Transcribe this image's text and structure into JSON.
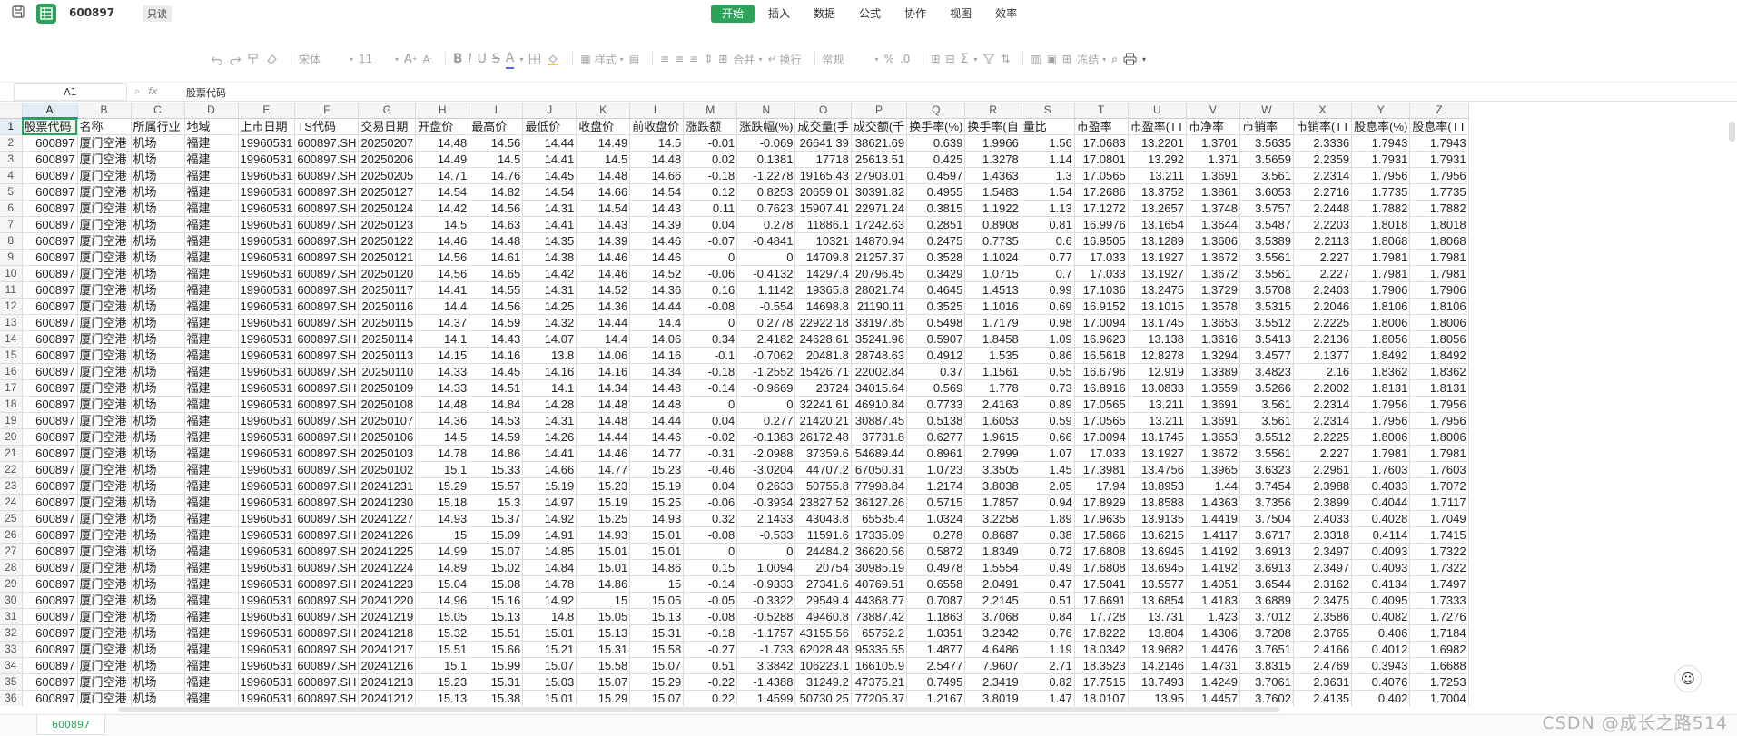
{
  "app": {
    "file_name": "600897",
    "mode_badge": "只读",
    "brand_color": "#2ba35a"
  },
  "menu_tabs": [
    "开始",
    "插入",
    "数据",
    "公式",
    "协作",
    "视图",
    "效率"
  ],
  "toolbar": {
    "font_name": "宋体",
    "font_size": "11",
    "style_label": "样式",
    "format_label": "常规",
    "merge_label": "合并",
    "wrap_label": "换行",
    "freeze_label": "冻结"
  },
  "formula_bar": {
    "cell_ref": "A1",
    "content": "股票代码"
  },
  "grid": {
    "columns": [
      "A",
      "B",
      "C",
      "D",
      "E",
      "F",
      "G",
      "H",
      "I",
      "J",
      "K",
      "L",
      "M",
      "N",
      "O",
      "P",
      "Q",
      "R",
      "S",
      "T",
      "U",
      "V",
      "W",
      "X",
      "Y",
      "Z"
    ],
    "rows": [
      [
        "股票代码",
        "名称",
        "所属行业",
        "地域",
        "上市日期",
        "TS代码",
        "交易日期",
        "开盘价",
        "最高价",
        "最低价",
        "收盘价",
        "前收盘价",
        "涨跌额",
        "涨跌幅(%)",
        "成交量(手",
        "成交额(千",
        "换手率(%)",
        "换手率(自",
        "量比",
        "市盈率",
        "市盈率(TT",
        "市净率",
        "市销率",
        "市销率(TT",
        "股息率(%)",
        "股息率(TT"
      ],
      [
        "600897",
        "厦门空港",
        "机场",
        "福建",
        "19960531",
        "600897.SH",
        "20250207",
        "14.48",
        "14.56",
        "14.44",
        "14.49",
        "14.5",
        "-0.01",
        "-0.069",
        "26641.39",
        "38621.69",
        "0.639",
        "1.9966",
        "1.56",
        "17.0683",
        "13.2201",
        "1.3701",
        "3.5635",
        "2.3336",
        "1.7943",
        "1.7943"
      ],
      [
        "600897",
        "厦门空港",
        "机场",
        "福建",
        "19960531",
        "600897.SH",
        "20250206",
        "14.49",
        "14.5",
        "14.41",
        "14.5",
        "14.48",
        "0.02",
        "0.1381",
        "17718",
        "25613.51",
        "0.425",
        "1.3278",
        "1.14",
        "17.0801",
        "13.292",
        "1.371",
        "3.5659",
        "2.2359",
        "1.7931",
        "1.7931"
      ],
      [
        "600897",
        "厦门空港",
        "机场",
        "福建",
        "19960531",
        "600897.SH",
        "20250205",
        "14.71",
        "14.76",
        "14.45",
        "14.48",
        "14.66",
        "-0.18",
        "-1.2278",
        "19165.43",
        "27903.01",
        "0.4597",
        "1.4363",
        "1.3",
        "17.0565",
        "13.211",
        "1.3691",
        "3.561",
        "2.2314",
        "1.7956",
        "1.7956"
      ],
      [
        "600897",
        "厦门空港",
        "机场",
        "福建",
        "19960531",
        "600897.SH",
        "20250127",
        "14.54",
        "14.82",
        "14.54",
        "14.66",
        "14.54",
        "0.12",
        "0.8253",
        "20659.01",
        "30391.82",
        "0.4955",
        "1.5483",
        "1.54",
        "17.2686",
        "13.3752",
        "1.3861",
        "3.6053",
        "2.2716",
        "1.7735",
        "1.7735"
      ],
      [
        "600897",
        "厦门空港",
        "机场",
        "福建",
        "19960531",
        "600897.SH",
        "20250124",
        "14.42",
        "14.56",
        "14.31",
        "14.54",
        "14.43",
        "0.11",
        "0.7623",
        "15907.41",
        "22971.24",
        "0.3815",
        "1.1922",
        "1.13",
        "17.1272",
        "13.2657",
        "1.3748",
        "3.5757",
        "2.2448",
        "1.7882",
        "1.7882"
      ],
      [
        "600897",
        "厦门空港",
        "机场",
        "福建",
        "19960531",
        "600897.SH",
        "20250123",
        "14.5",
        "14.63",
        "14.41",
        "14.43",
        "14.39",
        "0.04",
        "0.278",
        "11886.1",
        "17242.63",
        "0.2851",
        "0.8908",
        "0.81",
        "16.9976",
        "13.1654",
        "1.3644",
        "3.5487",
        "2.2203",
        "1.8018",
        "1.8018"
      ],
      [
        "600897",
        "厦门空港",
        "机场",
        "福建",
        "19960531",
        "600897.SH",
        "20250122",
        "14.46",
        "14.48",
        "14.35",
        "14.39",
        "14.46",
        "-0.07",
        "-0.4841",
        "10321",
        "14870.94",
        "0.2475",
        "0.7735",
        "0.6",
        "16.9505",
        "13.1289",
        "1.3606",
        "3.5389",
        "2.2113",
        "1.8068",
        "1.8068"
      ],
      [
        "600897",
        "厦门空港",
        "机场",
        "福建",
        "19960531",
        "600897.SH",
        "20250121",
        "14.56",
        "14.61",
        "14.38",
        "14.46",
        "14.46",
        "0",
        "0",
        "14709.8",
        "21257.37",
        "0.3528",
        "1.1024",
        "0.77",
        "17.033",
        "13.1927",
        "1.3672",
        "3.5561",
        "2.227",
        "1.7981",
        "1.7981"
      ],
      [
        "600897",
        "厦门空港",
        "机场",
        "福建",
        "19960531",
        "600897.SH",
        "20250120",
        "14.56",
        "14.65",
        "14.42",
        "14.46",
        "14.52",
        "-0.06",
        "-0.4132",
        "14297.4",
        "20796.45",
        "0.3429",
        "1.0715",
        "0.7",
        "17.033",
        "13.1927",
        "1.3672",
        "3.5561",
        "2.227",
        "1.7981",
        "1.7981"
      ],
      [
        "600897",
        "厦门空港",
        "机场",
        "福建",
        "19960531",
        "600897.SH",
        "20250117",
        "14.41",
        "14.55",
        "14.31",
        "14.52",
        "14.36",
        "0.16",
        "1.1142",
        "19365.8",
        "28021.74",
        "0.4645",
        "1.4513",
        "0.99",
        "17.1036",
        "13.2475",
        "1.3729",
        "3.5708",
        "2.2403",
        "1.7906",
        "1.7906"
      ],
      [
        "600897",
        "厦门空港",
        "机场",
        "福建",
        "19960531",
        "600897.SH",
        "20250116",
        "14.4",
        "14.56",
        "14.25",
        "14.36",
        "14.44",
        "-0.08",
        "-0.554",
        "14698.8",
        "21190.11",
        "0.3525",
        "1.1016",
        "0.69",
        "16.9152",
        "13.1015",
        "1.3578",
        "3.5315",
        "2.2046",
        "1.8106",
        "1.8106"
      ],
      [
        "600897",
        "厦门空港",
        "机场",
        "福建",
        "19960531",
        "600897.SH",
        "20250115",
        "14.37",
        "14.59",
        "14.32",
        "14.44",
        "14.4",
        "0",
        "0.2778",
        "22922.18",
        "33197.85",
        "0.5498",
        "1.7179",
        "0.98",
        "17.0094",
        "13.1745",
        "1.3653",
        "3.5512",
        "2.2225",
        "1.8006",
        "1.8006"
      ],
      [
        "600897",
        "厦门空港",
        "机场",
        "福建",
        "19960531",
        "600897.SH",
        "20250114",
        "14.1",
        "14.43",
        "14.07",
        "14.4",
        "14.06",
        "0.34",
        "2.4182",
        "24628.61",
        "35241.96",
        "0.5907",
        "1.8458",
        "1.09",
        "16.9623",
        "13.138",
        "1.3616",
        "3.5413",
        "2.2136",
        "1.8056",
        "1.8056"
      ],
      [
        "600897",
        "厦门空港",
        "机场",
        "福建",
        "19960531",
        "600897.SH",
        "20250113",
        "14.15",
        "14.16",
        "13.8",
        "14.06",
        "14.16",
        "-0.1",
        "-0.7062",
        "20481.8",
        "28748.63",
        "0.4912",
        "1.535",
        "0.86",
        "16.5618",
        "12.8278",
        "1.3294",
        "3.4577",
        "2.1377",
        "1.8492",
        "1.8492"
      ],
      [
        "600897",
        "厦门空港",
        "机场",
        "福建",
        "19960531",
        "600897.SH",
        "20250110",
        "14.33",
        "14.45",
        "14.16",
        "14.16",
        "14.34",
        "-0.18",
        "-1.2552",
        "15426.71",
        "22002.84",
        "0.37",
        "1.1561",
        "0.55",
        "16.6796",
        "12.919",
        "1.3389",
        "3.4823",
        "2.16",
        "1.8362",
        "1.8362"
      ],
      [
        "600897",
        "厦门空港",
        "机场",
        "福建",
        "19960531",
        "600897.SH",
        "20250109",
        "14.33",
        "14.51",
        "14.1",
        "14.34",
        "14.48",
        "-0.14",
        "-0.9669",
        "23724",
        "34015.64",
        "0.569",
        "1.778",
        "0.73",
        "16.8916",
        "13.0833",
        "1.3559",
        "3.5266",
        "2.2002",
        "1.8131",
        "1.8131"
      ],
      [
        "600897",
        "厦门空港",
        "机场",
        "福建",
        "19960531",
        "600897.SH",
        "20250108",
        "14.48",
        "14.84",
        "14.28",
        "14.48",
        "14.48",
        "0",
        "0",
        "32241.61",
        "46910.84",
        "0.7733",
        "2.4163",
        "0.89",
        "17.0565",
        "13.211",
        "1.3691",
        "3.561",
        "2.2314",
        "1.7956",
        "1.7956"
      ],
      [
        "600897",
        "厦门空港",
        "机场",
        "福建",
        "19960531",
        "600897.SH",
        "20250107",
        "14.36",
        "14.53",
        "14.31",
        "14.48",
        "14.44",
        "0.04",
        "0.277",
        "21420.21",
        "30887.45",
        "0.5138",
        "1.6053",
        "0.59",
        "17.0565",
        "13.211",
        "1.3691",
        "3.561",
        "2.2314",
        "1.7956",
        "1.7956"
      ],
      [
        "600897",
        "厦门空港",
        "机场",
        "福建",
        "19960531",
        "600897.SH",
        "20250106",
        "14.5",
        "14.59",
        "14.26",
        "14.44",
        "14.46",
        "-0.02",
        "-0.1383",
        "26172.48",
        "37731.8",
        "0.6277",
        "1.9615",
        "0.66",
        "17.0094",
        "13.1745",
        "1.3653",
        "3.5512",
        "2.2225",
        "1.8006",
        "1.8006"
      ],
      [
        "600897",
        "厦门空港",
        "机场",
        "福建",
        "19960531",
        "600897.SH",
        "20250103",
        "14.78",
        "14.86",
        "14.41",
        "14.46",
        "14.77",
        "-0.31",
        "-2.0988",
        "37359.6",
        "54689.44",
        "0.8961",
        "2.7999",
        "1.07",
        "17.033",
        "13.1927",
        "1.3672",
        "3.5561",
        "2.227",
        "1.7981",
        "1.7981"
      ],
      [
        "600897",
        "厦门空港",
        "机场",
        "福建",
        "19960531",
        "600897.SH",
        "20250102",
        "15.1",
        "15.33",
        "14.66",
        "14.77",
        "15.23",
        "-0.46",
        "-3.0204",
        "44707.2",
        "67050.31",
        "1.0723",
        "3.3505",
        "1.45",
        "17.3981",
        "13.4756",
        "1.3965",
        "3.6323",
        "2.2961",
        "1.7603",
        "1.7603"
      ],
      [
        "600897",
        "厦门空港",
        "机场",
        "福建",
        "19960531",
        "600897.SH",
        "20241231",
        "15.29",
        "15.57",
        "15.19",
        "15.23",
        "15.19",
        "0.04",
        "0.2633",
        "50755.8",
        "77998.84",
        "1.2174",
        "3.8038",
        "2.05",
        "17.94",
        "13.8953",
        "1.44",
        "3.7454",
        "2.3988",
        "0.4033",
        "1.7072"
      ],
      [
        "600897",
        "厦门空港",
        "机场",
        "福建",
        "19960531",
        "600897.SH",
        "20241230",
        "15.18",
        "15.3",
        "14.97",
        "15.19",
        "15.25",
        "-0.06",
        "-0.3934",
        "23827.52",
        "36127.26",
        "0.5715",
        "1.7857",
        "0.94",
        "17.8929",
        "13.8588",
        "1.4363",
        "3.7356",
        "2.3899",
        "0.4044",
        "1.7117"
      ],
      [
        "600897",
        "厦门空港",
        "机场",
        "福建",
        "19960531",
        "600897.SH",
        "20241227",
        "14.93",
        "15.37",
        "14.92",
        "15.25",
        "14.93",
        "0.32",
        "2.1433",
        "43043.8",
        "65535.4",
        "1.0324",
        "3.2258",
        "1.89",
        "17.9635",
        "13.9135",
        "1.4419",
        "3.7504",
        "2.4033",
        "0.4028",
        "1.7049"
      ],
      [
        "600897",
        "厦门空港",
        "机场",
        "福建",
        "19960531",
        "600897.SH",
        "20241226",
        "15",
        "15.09",
        "14.91",
        "14.93",
        "15.01",
        "-0.08",
        "-0.533",
        "11591.6",
        "17335.09",
        "0.278",
        "0.8687",
        "0.38",
        "17.5866",
        "13.6215",
        "1.4117",
        "3.6717",
        "2.3318",
        "0.4114",
        "1.7415"
      ],
      [
        "600897",
        "厦门空港",
        "机场",
        "福建",
        "19960531",
        "600897.SH",
        "20241225",
        "14.99",
        "15.07",
        "14.85",
        "15.01",
        "15.01",
        "0",
        "0",
        "24484.2",
        "36620.56",
        "0.5872",
        "1.8349",
        "0.72",
        "17.6808",
        "13.6945",
        "1.4192",
        "3.6913",
        "2.3497",
        "0.4093",
        "1.7322"
      ],
      [
        "600897",
        "厦门空港",
        "机场",
        "福建",
        "19960531",
        "600897.SH",
        "20241224",
        "14.89",
        "15.02",
        "14.84",
        "15.01",
        "14.86",
        "0.15",
        "1.0094",
        "20754",
        "30985.19",
        "0.4978",
        "1.5554",
        "0.49",
        "17.6808",
        "13.6945",
        "1.4192",
        "3.6913",
        "2.3497",
        "0.4093",
        "1.7322"
      ],
      [
        "600897",
        "厦门空港",
        "机场",
        "福建",
        "19960531",
        "600897.SH",
        "20241223",
        "15.04",
        "15.08",
        "14.78",
        "14.86",
        "15",
        "-0.14",
        "-0.9333",
        "27341.6",
        "40769.51",
        "0.6558",
        "2.0491",
        "0.47",
        "17.5041",
        "13.5577",
        "1.4051",
        "3.6544",
        "2.3162",
        "0.4134",
        "1.7497"
      ],
      [
        "600897",
        "厦门空港",
        "机场",
        "福建",
        "19960531",
        "600897.SH",
        "20241220",
        "14.96",
        "15.16",
        "14.92",
        "15",
        "15.05",
        "-0.05",
        "-0.3322",
        "29549.4",
        "44368.77",
        "0.7087",
        "2.2145",
        "0.51",
        "17.6691",
        "13.6854",
        "1.4183",
        "3.6889",
        "2.3475",
        "0.4095",
        "1.7333"
      ],
      [
        "600897",
        "厦门空港",
        "机场",
        "福建",
        "19960531",
        "600897.SH",
        "20241219",
        "15.05",
        "15.13",
        "14.8",
        "15.05",
        "15.13",
        "-0.08",
        "-0.5288",
        "49460.8",
        "73887.42",
        "1.1863",
        "3.7068",
        "0.84",
        "17.728",
        "13.731",
        "1.423",
        "3.7012",
        "2.3586",
        "0.4082",
        "1.7276"
      ],
      [
        "600897",
        "厦门空港",
        "机场",
        "福建",
        "19960531",
        "600897.SH",
        "20241218",
        "15.32",
        "15.51",
        "15.01",
        "15.13",
        "15.31",
        "-0.18",
        "-1.1757",
        "43155.56",
        "65752.2",
        "1.0351",
        "3.2342",
        "0.76",
        "17.8222",
        "13.804",
        "1.4306",
        "3.7208",
        "2.3765",
        "0.406",
        "1.7184"
      ],
      [
        "600897",
        "厦门空港",
        "机场",
        "福建",
        "19960531",
        "600897.SH",
        "20241217",
        "15.51",
        "15.66",
        "15.21",
        "15.31",
        "15.58",
        "-0.27",
        "-1.733",
        "62028.48",
        "95335.55",
        "1.4877",
        "4.6486",
        "1.19",
        "18.0342",
        "13.9682",
        "1.4476",
        "3.7651",
        "2.4166",
        "0.4012",
        "1.6982"
      ],
      [
        "600897",
        "厦门空港",
        "机场",
        "福建",
        "19960531",
        "600897.SH",
        "20241216",
        "15.1",
        "15.99",
        "15.07",
        "15.58",
        "15.07",
        "0.51",
        "3.3842",
        "106223.1",
        "166105.9",
        "2.5477",
        "7.9607",
        "2.71",
        "18.3523",
        "14.2146",
        "1.4731",
        "3.8315",
        "2.4769",
        "0.3943",
        "1.6688"
      ],
      [
        "600897",
        "厦门空港",
        "机场",
        "福建",
        "19960531",
        "600897.SH",
        "20241213",
        "15.23",
        "15.31",
        "15.03",
        "15.07",
        "15.29",
        "-0.22",
        "-1.4388",
        "31249.2",
        "47375.21",
        "0.7495",
        "2.3419",
        "0.82",
        "17.7515",
        "13.7493",
        "1.4249",
        "3.7061",
        "2.3631",
        "0.4076",
        "1.7253"
      ],
      [
        "600897",
        "厦门空港",
        "机场",
        "福建",
        "19960531",
        "600897.SH",
        "20241212",
        "15.13",
        "15.38",
        "15.01",
        "15.29",
        "15.07",
        "0.22",
        "1.4599",
        "50730.25",
        "77205.37",
        "1.2167",
        "3.8019",
        "1.47",
        "18.0107",
        "13.95",
        "1.4457",
        "3.7602",
        "2.4135",
        "0.402",
        "1.7004"
      ]
    ]
  },
  "sheet_tabs": [
    "600897"
  ],
  "watermark": "CSDN @成长之路514"
}
